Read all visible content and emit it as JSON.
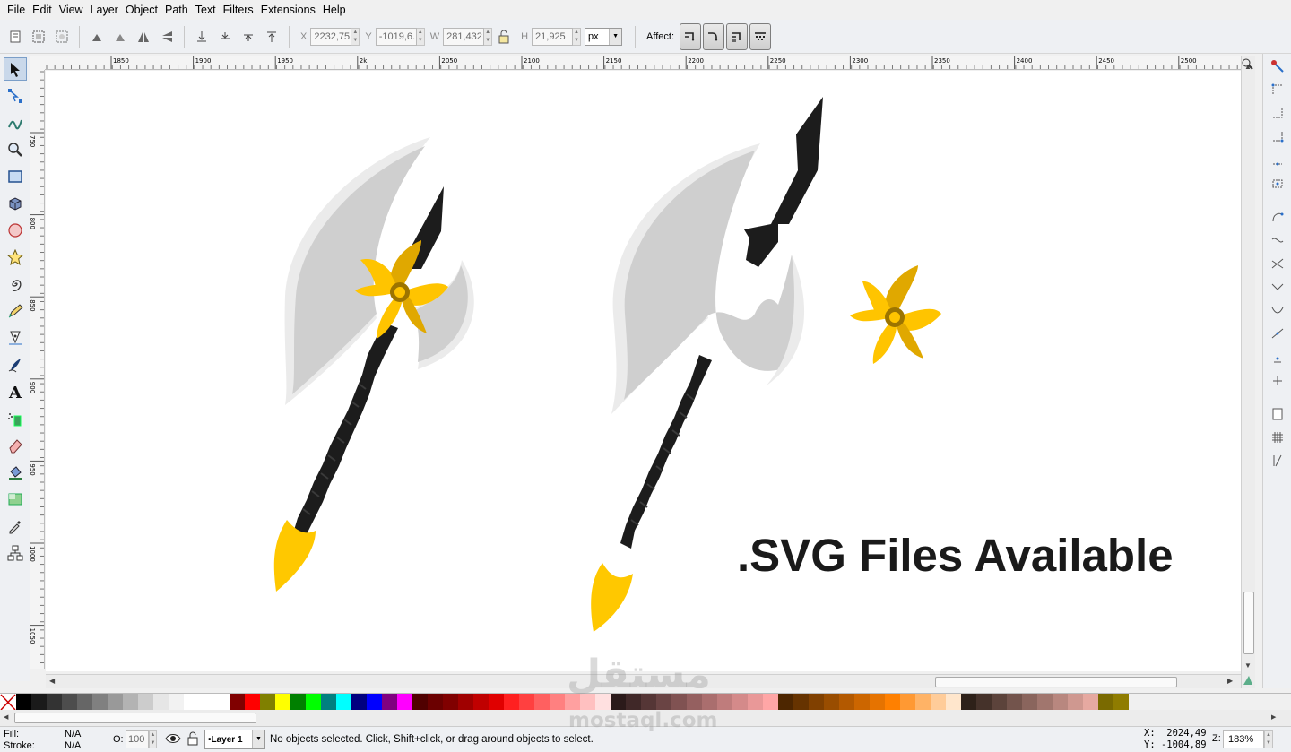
{
  "menu": [
    "File",
    "Edit",
    "View",
    "Layer",
    "Object",
    "Path",
    "Text",
    "Filters",
    "Extensions",
    "Help"
  ],
  "toolbar": {
    "x_label": "X",
    "x_value": "2232,75",
    "y_label": "Y",
    "y_value": "-1019,6.",
    "w_label": "W",
    "w_value": "281,432",
    "h_label": "H",
    "h_value": "21,925",
    "unit": "px",
    "affect_label": "Affect:"
  },
  "ruler": {
    "h_ticks": [
      "1850",
      "1900",
      "1950",
      "2k",
      "2050",
      "2100",
      "2150",
      "2200",
      "2250",
      "2300",
      "2350",
      "2400",
      "2450",
      "2500"
    ],
    "v_ticks": [
      "750",
      "800",
      "850",
      "900",
      "950",
      "1000",
      "1050"
    ]
  },
  "canvas": {
    "banner_text": ".SVG Files Available",
    "colors": {
      "blade_light": "#ebebeb",
      "blade_mid": "#cfcfcf",
      "handle": "#1c1c1c",
      "gold": "#ffc400",
      "gold_dark": "#e0a800",
      "ring": "#9c7400"
    }
  },
  "status": {
    "fill_label": "Fill:",
    "fill_value": "N/A",
    "stroke_label": "Stroke:",
    "stroke_value": "N/A",
    "opacity_label": "O:",
    "opacity_value": "100",
    "layer": "•Layer 1",
    "message": "No objects selected. Click, Shift+click, or drag around objects to select.",
    "cursor_x": "X:  2024,49",
    "cursor_y": "Y: -1004,89",
    "zoom_label": "Z:",
    "zoom_value": "183%"
  },
  "watermark": {
    "arabic": "مستقل",
    "latin": "mostaql.com"
  },
  "palette": [
    "#000000",
    "#1a1a1a",
    "#333333",
    "#4d4d4d",
    "#666666",
    "#808080",
    "#999999",
    "#b3b3b3",
    "#cccccc",
    "#e6e6e6",
    "#f2f2f2",
    "#ffffff",
    "#ffffff",
    "#ffffff",
    "#800000",
    "#ff0000",
    "#808000",
    "#ffff00",
    "#008000",
    "#00ff00",
    "#008080",
    "#00ffff",
    "#000080",
    "#0000ff",
    "#800080",
    "#ff00ff",
    "#500000",
    "#6b0000",
    "#800000",
    "#a00000",
    "#c00000",
    "#e00000",
    "#ff2020",
    "#ff4040",
    "#ff6060",
    "#ff8080",
    "#ffa0a0",
    "#ffc0c0",
    "#ffe0e0",
    "#2b1a1a",
    "#402828",
    "#553636",
    "#6a4444",
    "#805252",
    "#956060",
    "#aa6e6e",
    "#bf7c7c",
    "#d48a8a",
    "#e99898",
    "#ffa6a6",
    "#4d2600",
    "#663300",
    "#804000",
    "#994d00",
    "#b35900",
    "#cc6600",
    "#e67300",
    "#ff8000",
    "#ff9933",
    "#ffb366",
    "#ffcc99",
    "#ffe6cc",
    "#2e2119",
    "#45322a",
    "#5c433b",
    "#73544c",
    "#8a655d",
    "#a1766e",
    "#b8877f",
    "#cf9890",
    "#e6a9a1",
    "#7a6a00",
    "#8f7c00"
  ]
}
